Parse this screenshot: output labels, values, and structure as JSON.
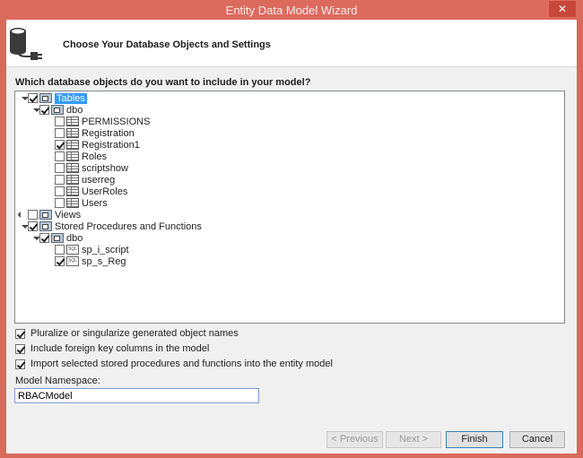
{
  "window": {
    "title": "Entity Data Model Wizard",
    "close_glyph": "✕"
  },
  "header": {
    "title": "Choose Your Database Objects and Settings",
    "icon": "database-plug-icon"
  },
  "question": "Which database objects do you want to include in your model?",
  "tree": {
    "tables_label": "Tables",
    "tables_dbo": "dbo",
    "tables": [
      {
        "label": "PERMISSIONS",
        "checked": false
      },
      {
        "label": "Registration",
        "checked": false
      },
      {
        "label": "Registration1",
        "checked": true
      },
      {
        "label": "Roles",
        "checked": false
      },
      {
        "label": "scriptshow",
        "checked": false
      },
      {
        "label": "userreg",
        "checked": false
      },
      {
        "label": "UserRoles",
        "checked": false
      },
      {
        "label": "Users",
        "checked": false
      }
    ],
    "views_label": "Views",
    "procs_label": "Stored Procedures and Functions",
    "procs_dbo": "dbo",
    "procs": [
      {
        "label": "sp_i_script",
        "checked": false
      },
      {
        "label": "sp_s_Reg",
        "checked": true
      }
    ],
    "sql_icon_text": "SQL"
  },
  "options": {
    "pluralize": "Pluralize or singularize generated object names",
    "foreign_keys": "Include foreign key columns in the model",
    "import_procs": "Import selected stored procedures and functions into the entity model"
  },
  "namespace": {
    "label": "Model Namespace:",
    "value": "RBACModel"
  },
  "buttons": {
    "previous": "< Previous",
    "next": "Next >",
    "finish": "Finish",
    "cancel": "Cancel"
  }
}
